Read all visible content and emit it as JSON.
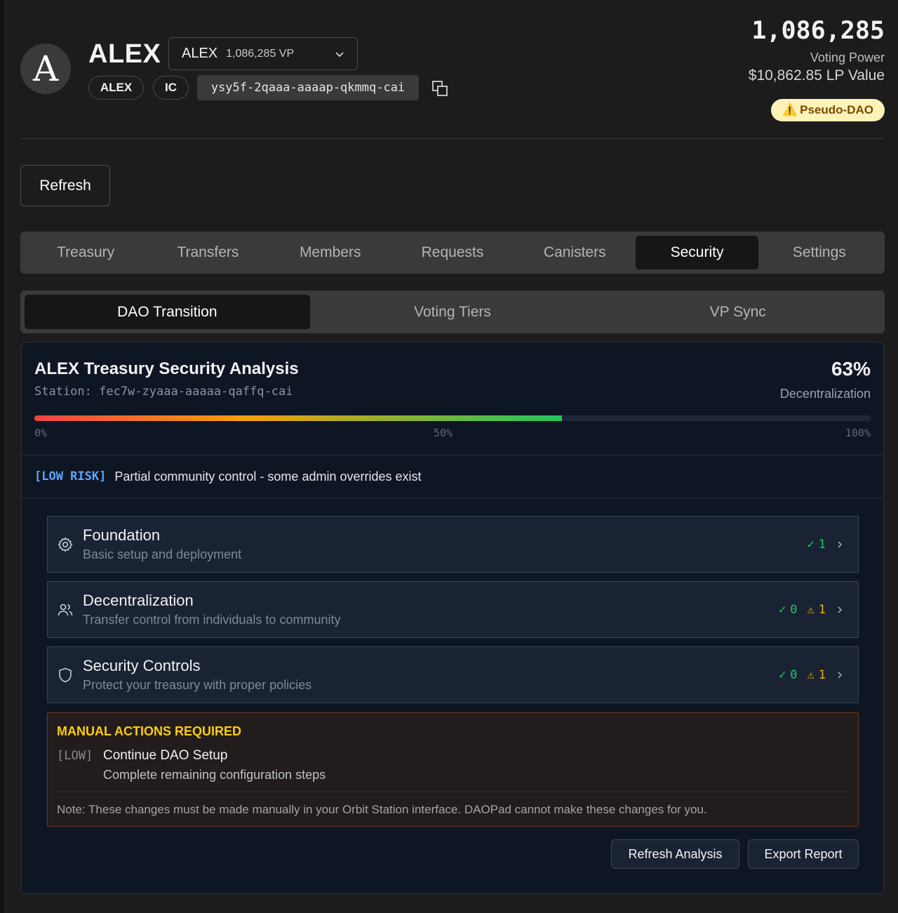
{
  "header": {
    "avatar_letter": "A",
    "title": "ALEX",
    "token_select": {
      "symbol": "ALEX",
      "vp": "1,086,285 VP"
    },
    "tags": [
      "ALEX",
      "IC"
    ],
    "canister_id": "ysy5f-2qaaa-aaaap-qkmmq-cai",
    "voting_power": "1,086,285",
    "voting_power_label": "Voting Power",
    "lp_value": "$10,862.85 LP Value",
    "badge": "Pseudo-DAO",
    "badge_icon": "⚠️"
  },
  "refresh_label": "Refresh",
  "tabs": [
    "Treasury",
    "Transfers",
    "Members",
    "Requests",
    "Canisters",
    "Security",
    "Settings"
  ],
  "active_tab": "Security",
  "subtabs": [
    "DAO Transition",
    "Voting Tiers",
    "VP Sync"
  ],
  "active_subtab": "DAO Transition",
  "analysis": {
    "title": "ALEX Treasury Security Analysis",
    "station": "Station: fec7w-zyaaa-aaaaa-qaffq-cai",
    "percent_text": "63%",
    "percent_value": 63,
    "percent_label": "Decentralization",
    "bar_labels": [
      "0%",
      "50%",
      "100%"
    ],
    "risk_tag": "[LOW RISK]",
    "risk_text": "Partial community control - some admin overrides exist",
    "sections": [
      {
        "name": "Foundation",
        "desc": "Basic setup and deployment",
        "icon": "gear-icon",
        "ok": "1",
        "warn": null
      },
      {
        "name": "Decentralization",
        "desc": "Transfer control from individuals to community",
        "icon": "users-icon",
        "ok": "0",
        "warn": "1"
      },
      {
        "name": "Security Controls",
        "desc": "Protect your treasury with proper policies",
        "icon": "shield-icon",
        "ok": "0",
        "warn": "1"
      }
    ],
    "check_glyph": "✓",
    "warn_glyph": "⚠",
    "manual": {
      "title": "MANUAL ACTIONS REQUIRED",
      "tag": "[LOW]",
      "item": "Continue DAO Setup",
      "desc": "Complete remaining configuration steps",
      "note": "Note: These changes must be made manually in your Orbit Station interface. DAOPad cannot make these changes for you."
    },
    "buttons": {
      "refresh": "Refresh Analysis",
      "export": "Export Report"
    }
  },
  "colors": {
    "ok": "#22c55e",
    "warn": "#eab308",
    "risk": "#60a5fa",
    "badge_bg": "#fdf3b8"
  }
}
